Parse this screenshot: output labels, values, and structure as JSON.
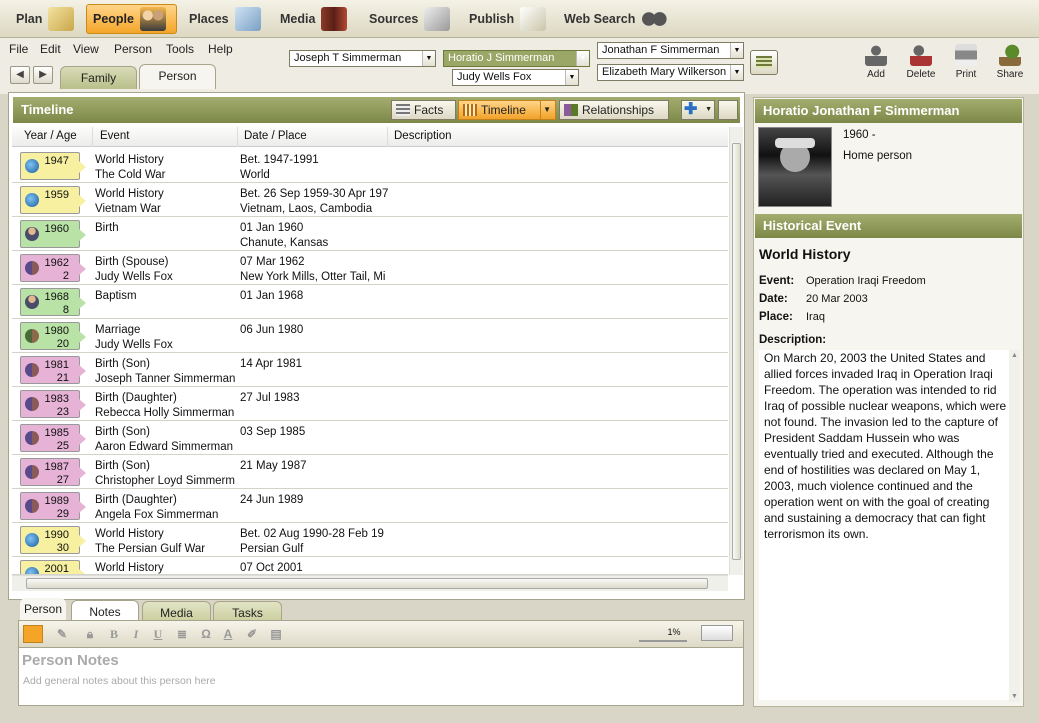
{
  "modules": [
    {
      "label": "Plan",
      "icon": "plan-icon"
    },
    {
      "label": "People",
      "icon": "people-icon",
      "active": true
    },
    {
      "label": "Places",
      "icon": "places-icon"
    },
    {
      "label": "Media",
      "icon": "media-icon"
    },
    {
      "label": "Sources",
      "icon": "sources-icon"
    },
    {
      "label": "Publish",
      "icon": "publish-icon"
    },
    {
      "label": "Web Search",
      "icon": "web-search-icon"
    }
  ],
  "menu": [
    "File",
    "Edit",
    "View",
    "Person",
    "Tools",
    "Help"
  ],
  "nav_tabs": {
    "family": "Family",
    "person": "Person"
  },
  "family_selectors": {
    "child": "Joseph T Simmerman",
    "selected": "Horatio J Simmerman",
    "spouse": "Judy Wells Fox",
    "father": "Jonathan F Simmerman",
    "mother": "Elizabeth Mary Wilkerson"
  },
  "tools": [
    {
      "label": "Add",
      "icon": "add-person-icon"
    },
    {
      "label": "Delete",
      "icon": "delete-person-icon"
    },
    {
      "label": "Print",
      "icon": "print-icon"
    },
    {
      "label": "Share",
      "icon": "share-icon"
    }
  ],
  "timeline": {
    "title": "Timeline",
    "view_buttons": {
      "facts": "Facts",
      "timeline": "Timeline",
      "relationships": "Relationships"
    },
    "columns": {
      "year_age": "Year / Age",
      "event": "Event",
      "date_place": "Date / Place",
      "description": "Description"
    },
    "rows": [
      {
        "year": "1947",
        "age": "",
        "event": "World History",
        "sub": "The Cold War",
        "date": "Bet. 1947-1991",
        "place": "World",
        "kind": "history"
      },
      {
        "year": "1959",
        "age": "",
        "event": "World History",
        "sub": "Vietnam War",
        "date": "Bet. 26 Sep 1959-30 Apr 197",
        "place": "Vietnam, Laos, Cambodia",
        "kind": "history"
      },
      {
        "year": "1960",
        "age": "",
        "event": "Birth",
        "sub": "",
        "date": "01 Jan 1960",
        "place": "Chanute, Kansas",
        "kind": "personal"
      },
      {
        "year": "1962",
        "age": "2",
        "event": "Birth (Spouse)",
        "sub": "Judy Wells Fox",
        "date": "07 Mar 1962",
        "place": "New York Mills, Otter Tail, Mi",
        "kind": "family"
      },
      {
        "year": "1968",
        "age": "8",
        "event": "Baptism",
        "sub": "",
        "date": "01 Jan 1968",
        "place": "",
        "kind": "personal"
      },
      {
        "year": "1980",
        "age": "20",
        "event": "Marriage",
        "sub": "Judy Wells Fox",
        "date": "06 Jun 1980",
        "place": "",
        "kind": "marriage"
      },
      {
        "year": "1981",
        "age": "21",
        "event": "Birth (Son)",
        "sub": "Joseph Tanner Simmerman",
        "date": "14 Apr 1981",
        "place": "",
        "kind": "family"
      },
      {
        "year": "1983",
        "age": "23",
        "event": "Birth (Daughter)",
        "sub": "Rebecca Holly Simmerman",
        "date": "27 Jul 1983",
        "place": "",
        "kind": "family"
      },
      {
        "year": "1985",
        "age": "25",
        "event": "Birth (Son)",
        "sub": "Aaron Edward Simmerman",
        "date": "03 Sep 1985",
        "place": "",
        "kind": "family"
      },
      {
        "year": "1987",
        "age": "27",
        "event": "Birth (Son)",
        "sub": "Christopher Loyd Simmerm",
        "date": "21 May 1987",
        "place": "",
        "kind": "family"
      },
      {
        "year": "1989",
        "age": "29",
        "event": "Birth (Daughter)",
        "sub": "Angela Fox Simmerman",
        "date": "24 Jun 1989",
        "place": "",
        "kind": "family"
      },
      {
        "year": "1990",
        "age": "30",
        "event": "World History",
        "sub": "The Persian Gulf War",
        "date": "Bet. 02 Aug 1990-28 Feb 19",
        "place": "Persian Gulf",
        "kind": "history"
      },
      {
        "year": "2001",
        "age": "",
        "event": "World History",
        "sub": "",
        "date": "07 Oct 2001",
        "place": "",
        "kind": "history"
      }
    ]
  },
  "bottom_tabs": [
    "Person",
    "Notes",
    "Media",
    "Tasks"
  ],
  "notes": {
    "title": "Person Notes",
    "placeholder": "Add general notes about this person here",
    "zoom": "1%"
  },
  "person_panel": {
    "name": "Horatio Jonathan F Simmerman",
    "years": "1960 -",
    "role": "Home person"
  },
  "historical_event": {
    "header": "Historical Event",
    "title": "World History",
    "event_label": "Event:",
    "event": "Operation Iraqi Freedom",
    "date_label": "Date:",
    "date": "20 Mar 2003",
    "place_label": "Place:",
    "place": "Iraq",
    "description_label": "Description:",
    "description": "On March 20, 2003 the United States and allied forces invaded Iraq in Operation Iraqi Freedom. The operation was intended to rid Iraq of possible nuclear weapons, which were not found. The invasion led to the capture of President Saddam Hussein who was eventually tried and executed. Although the end of hostilities was declared on May 1, 2003, much violence continued and the operation went on with the goal of creating and sustaining a democracy that can fight terrorismon its own."
  },
  "colors": {
    "history": "#f6f0a0",
    "personal": "#b8e2a6",
    "family": "#e6b3d6",
    "marriage": "#b8e2a6",
    "accent": "#7c8848",
    "active_tab": "#f4a528"
  }
}
